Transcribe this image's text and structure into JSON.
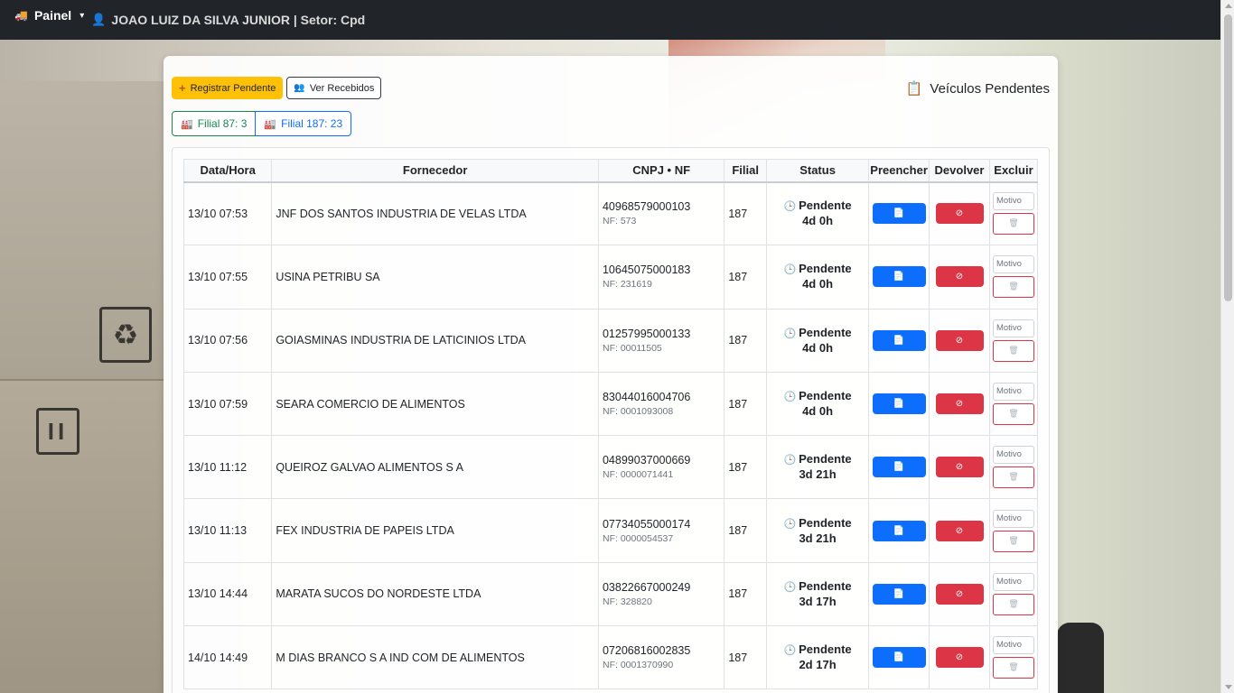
{
  "navbar": {
    "brand_label": "Painel",
    "brand_icon": "truck-icon",
    "caret": "▾",
    "user_icon": "person-icon",
    "user_text": "JOAO LUIZ DA SILVA JUNIOR | Setor: Cpd"
  },
  "toolbar": {
    "register_label": "Registrar Pendente",
    "received_label": "Ver Recebidos"
  },
  "page_title": "Veículos Pendentes",
  "filiais": [
    {
      "label": "Filial 87: 3",
      "color": "#198754"
    },
    {
      "label": "Filial 187: 23",
      "color": "#0d6efd"
    }
  ],
  "table": {
    "headers": [
      "Data/Hora",
      "Fornecedor",
      "CNPJ • NF",
      "Filial",
      "Status",
      "Preencher",
      "Devolver",
      "Excluir"
    ],
    "motivo_placeholder": "Motivo",
    "rows": [
      {
        "date": "13/10 07:53",
        "fornecedor": "JNF DOS SANTOS INDUSTRIA DE VELAS LTDA",
        "cnpj": "40968579000103",
        "nf": "NF: 573",
        "filial": "187",
        "status": "Pendente",
        "elapsed": "4d 0h"
      },
      {
        "date": "13/10 07:55",
        "fornecedor": "USINA PETRIBU SA",
        "cnpj": "10645075000183",
        "nf": "NF: 231619",
        "filial": "187",
        "status": "Pendente",
        "elapsed": "4d 0h"
      },
      {
        "date": "13/10 07:56",
        "fornecedor": "GOIASMINAS INDUSTRIA DE LATICINIOS LTDA",
        "cnpj": "01257995000133",
        "nf": "NF: 00011505",
        "filial": "187",
        "status": "Pendente",
        "elapsed": "4d 0h"
      },
      {
        "date": "13/10 07:59",
        "fornecedor": "SEARA COMERCIO DE ALIMENTOS",
        "cnpj": "83044016004706",
        "nf": "NF: 0001093008",
        "filial": "187",
        "status": "Pendente",
        "elapsed": "4d 0h"
      },
      {
        "date": "13/10 11:12",
        "fornecedor": "QUEIROZ GALVAO ALIMENTOS S A",
        "cnpj": "04899037000669",
        "nf": "NF: 0000071441",
        "filial": "187",
        "status": "Pendente",
        "elapsed": "3d 21h"
      },
      {
        "date": "13/10 11:13",
        "fornecedor": "FEX INDUSTRIA DE PAPEIS LTDA",
        "cnpj": "07734055000174",
        "nf": "NF: 0000054537",
        "filial": "187",
        "status": "Pendente",
        "elapsed": "3d 21h"
      },
      {
        "date": "13/10 14:44",
        "fornecedor": "MARATA SUCOS DO NORDESTE LTDA",
        "cnpj": "03822667000249",
        "nf": "NF: 328820",
        "filial": "187",
        "status": "Pendente",
        "elapsed": "3d 17h"
      },
      {
        "date": "14/10 14:49",
        "fornecedor": "M DIAS BRANCO S A IND COM DE ALIMENTOS",
        "cnpj": "07206816002835",
        "nf": "NF: 0001370990",
        "filial": "187",
        "status": "Pendente",
        "elapsed": "2d 17h"
      }
    ]
  }
}
